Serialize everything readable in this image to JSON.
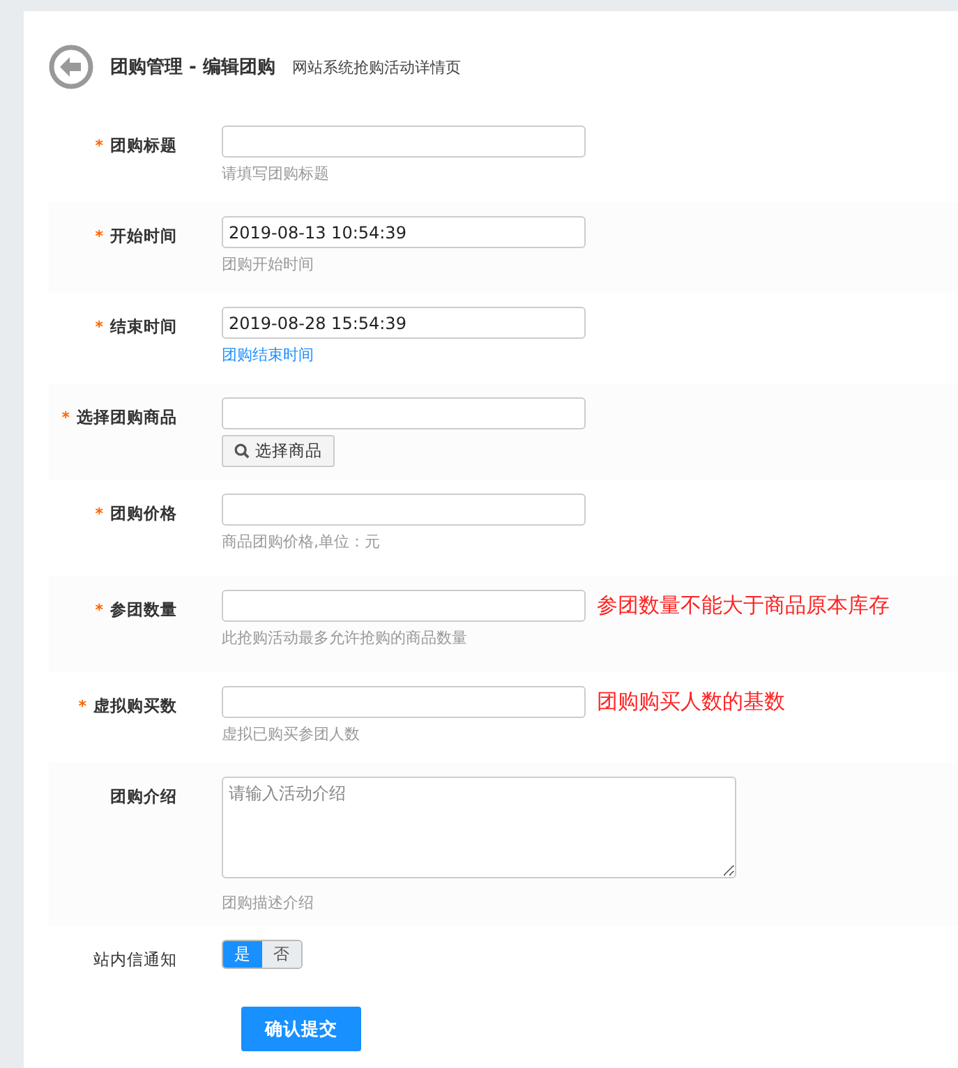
{
  "header": {
    "title": "团购管理 - 编辑团购",
    "subtitle": "网站系统抢购活动详情页"
  },
  "fields": [
    {
      "kind": "text",
      "label": "团购标题",
      "required_mark": "*",
      "hint": "请填写团购标题",
      "highlighted": false
    },
    {
      "kind": "text",
      "label": "开始时间",
      "required_mark": "*",
      "value": "2019-08-13 10:54:39",
      "hint": "团购开始时间",
      "highlighted": false
    },
    {
      "kind": "text",
      "label": "结束时间",
      "required_mark": "*",
      "value": "2019-08-28 15:54:39",
      "hint": "团购结束时间",
      "highlighted": true
    },
    {
      "kind": "picker",
      "label": "选择团购商品",
      "required_mark": "*",
      "button": "选择商品"
    },
    {
      "kind": "text",
      "label": "团购价格",
      "required_mark": "*",
      "hint": "商品团购价格,单位：元",
      "highlighted": false
    },
    {
      "kind": "text",
      "label": "参团数量",
      "required_mark": "*",
      "hint": "此抢购活动最多允许抢购的商品数量",
      "note": "参团数量不能大于商品原本库存",
      "highlighted": false
    },
    {
      "kind": "text",
      "label": "虚拟购买数",
      "required_mark": "*",
      "hint": "虚拟已购买参团人数",
      "note": "团购购买人数的基数",
      "highlighted": false
    },
    {
      "kind": "textarea",
      "label": "团购介绍",
      "placeholder": "请输入活动介绍",
      "hint": "团购描述介绍",
      "highlighted": false
    },
    {
      "kind": "toggle",
      "label": "站内信通知",
      "options": [
        {
          "label": "是",
          "selected": true
        },
        {
          "label": "否",
          "selected": false
        }
      ]
    }
  ],
  "submit": "确认提交"
}
